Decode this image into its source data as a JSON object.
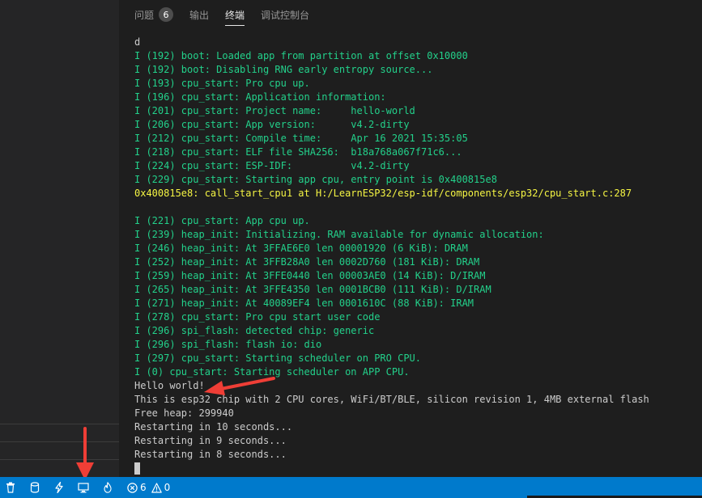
{
  "panel": {
    "tabs": [
      {
        "label": "问题",
        "count": "6"
      },
      {
        "label": "输出"
      },
      {
        "label": "终端"
      },
      {
        "label": "调试控制台"
      }
    ]
  },
  "terminal": {
    "lines": [
      "d",
      "I (192) boot: Loaded app from partition at offset 0x10000",
      "I (192) boot: Disabling RNG early entropy source...",
      "I (193) cpu_start: Pro cpu up.",
      "I (196) cpu_start: Application information:",
      "I (201) cpu_start: Project name:     hello-world",
      "I (206) cpu_start: App version:      v4.2-dirty",
      "I (212) cpu_start: Compile time:     Apr 16 2021 15:35:05",
      "I (218) cpu_start: ELF file SHA256:  b18a768a067f71c6...",
      "I (224) cpu_start: ESP-IDF:          v4.2-dirty",
      "I (229) cpu_start: Starting app cpu, entry point is 0x400815e8",
      "0x400815e8: call_start_cpu1 at H:/LearnESP32/esp-idf/components/esp32/cpu_start.c:287",
      "",
      "I (221) cpu_start: App cpu up.",
      "I (239) heap_init: Initializing. RAM available for dynamic allocation:",
      "I (246) heap_init: At 3FFAE6E0 len 00001920 (6 KiB): DRAM",
      "I (252) heap_init: At 3FFB28A0 len 0002D760 (181 KiB): DRAM",
      "I (259) heap_init: At 3FFE0440 len 00003AE0 (14 KiB): D/IRAM",
      "I (265) heap_init: At 3FFE4350 len 0001BCB0 (111 KiB): D/IRAM",
      "I (271) heap_init: At 40089EF4 len 0001610C (88 KiB): IRAM",
      "I (278) cpu_start: Pro cpu start user code",
      "I (296) spi_flash: detected chip: generic",
      "I (296) spi_flash: flash io: dio",
      "I (297) cpu_start: Starting scheduler on PRO CPU.",
      "I (0) cpu_start: Starting scheduler on APP CPU.",
      "Hello world!",
      "This is esp32 chip with 2 CPU cores, WiFi/BT/BLE, silicon revision 1, 4MB external flash",
      "Free heap: 299940",
      "Restarting in 10 seconds...",
      "Restarting in 9 seconds...",
      "Restarting in 8 seconds..."
    ],
    "line_colors": [
      "white",
      "green",
      "green",
      "green",
      "green",
      "green",
      "green",
      "green",
      "green",
      "green",
      "green",
      "yellow",
      "white",
      "green",
      "green",
      "green",
      "green",
      "green",
      "green",
      "green",
      "green",
      "green",
      "green",
      "green",
      "green",
      "white",
      "white",
      "white",
      "white",
      "white",
      "white"
    ]
  },
  "statusbar": {
    "errors": "6",
    "warnings": "0",
    "icons": [
      "trash-icon",
      "database-icon",
      "flash-icon",
      "monitor-icon",
      "flame-icon",
      "error-icon",
      "warning-icon"
    ]
  },
  "colors": {
    "statusbar": "#007acc",
    "log_info": "#23d18b",
    "log_addr": "#f5f543",
    "annotation_arrow": "#ef3e36"
  }
}
